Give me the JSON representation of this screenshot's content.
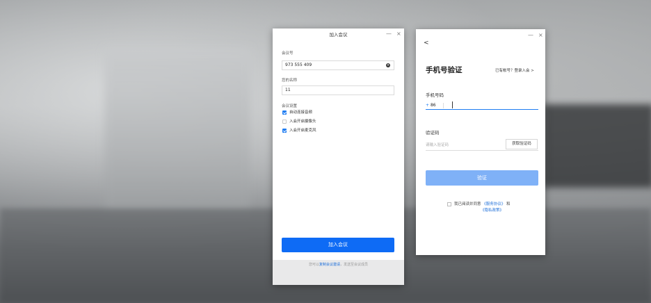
{
  "join_window": {
    "title": "加入会议",
    "minimize": "—",
    "close": "×",
    "meeting_id_label": "会议号",
    "meeting_id_value": "973 555 409",
    "name_label": "您的名称",
    "name_value": "11",
    "settings_label": "会议设置",
    "options": [
      {
        "label": "自动连接音频",
        "checked": true
      },
      {
        "label": "入会开启摄像头",
        "checked": false
      },
      {
        "label": "入会开启麦克风",
        "checked": true
      }
    ],
    "join_button": "加入会议",
    "footer_prefix": "您可以",
    "footer_link": "复制会议邀请",
    "footer_suffix": "，发送至会议成员"
  },
  "verify_window": {
    "minimize": "—",
    "close": "×",
    "back": "<",
    "title": "手机号验证",
    "login_link": "已有帐号？登录入会 >",
    "phone_label": "手机号码",
    "country_code_plus": "+",
    "country_code": "86",
    "code_label": "验证码",
    "code_placeholder": "请输入验证码",
    "get_code_button": "获取验证码",
    "verify_button": "验证",
    "agree_text": "我已阅读并同意",
    "service_link": "《服务协议》",
    "and_text": "和",
    "privacy_link": "《隐私政策》"
  },
  "colors": {
    "primary": "#0e6bf5",
    "primary_disabled": "#7fb1f7",
    "link": "#1e6fd9"
  }
}
